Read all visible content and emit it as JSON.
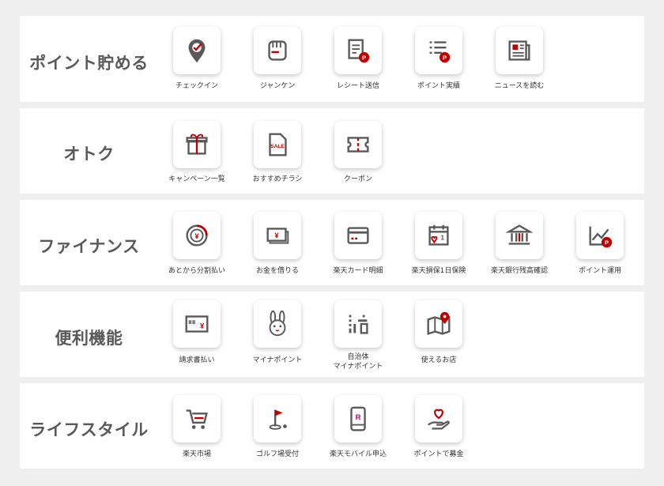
{
  "colors": {
    "accent": "#bf0000",
    "icon": "#595959",
    "background": "#efefef",
    "card": "#ffffff"
  },
  "sections": [
    {
      "title": "ポイント貯める",
      "items": [
        {
          "label": "チェックイン",
          "icon": "checkin-pin-icon"
        },
        {
          "label": "ジャンケン",
          "icon": "janken-fist-icon"
        },
        {
          "label": "レシート送信",
          "icon": "receipt-point-icon"
        },
        {
          "label": "ポイント実績",
          "icon": "point-history-icon"
        },
        {
          "label": "ニュースを読む",
          "icon": "newspaper-icon"
        }
      ]
    },
    {
      "title": "オトク",
      "items": [
        {
          "label": "キャンペーン一覧",
          "icon": "gift-icon"
        },
        {
          "label": "おすすめチラシ",
          "icon": "sale-flyer-icon",
          "icon_text": "SALE"
        },
        {
          "label": "クーポン",
          "icon": "coupon-icon"
        }
      ]
    },
    {
      "title": "ファイナンス",
      "items": [
        {
          "label": "あとから分割払い",
          "icon": "yen-circle-icon",
          "icon_text": "¥"
        },
        {
          "label": "お金を借りる",
          "icon": "borrow-money-icon",
          "icon_text": "¥"
        },
        {
          "label": "楽天カード明細",
          "icon": "credit-card-icon"
        },
        {
          "label": "楽天損保1日保険",
          "icon": "calendar-heart-icon",
          "icon_text": "1"
        },
        {
          "label": "楽天銀行残高確認",
          "icon": "bank-icon"
        },
        {
          "label": "ポイント運用",
          "icon": "point-investment-icon"
        }
      ]
    },
    {
      "title": "便利機能",
      "items": [
        {
          "label": "請求書払い",
          "icon": "bill-payment-icon",
          "icon_text": "¥"
        },
        {
          "label": "マイナポイント",
          "icon": "rabbit-icon"
        },
        {
          "label": "自治体\nマイナポイント",
          "icon": "municipality-icon"
        },
        {
          "label": "使えるお店",
          "icon": "store-map-icon"
        }
      ]
    },
    {
      "title": "ライフスタイル",
      "items": [
        {
          "label": "楽天市場",
          "icon": "shopping-cart-icon"
        },
        {
          "label": "ゴルフ場受付",
          "icon": "golf-flag-icon"
        },
        {
          "label": "楽天モバイル申込",
          "icon": "mobile-phone-icon",
          "icon_text": "R"
        },
        {
          "label": "ポイントで募金",
          "icon": "donation-heart-icon"
        }
      ]
    }
  ]
}
